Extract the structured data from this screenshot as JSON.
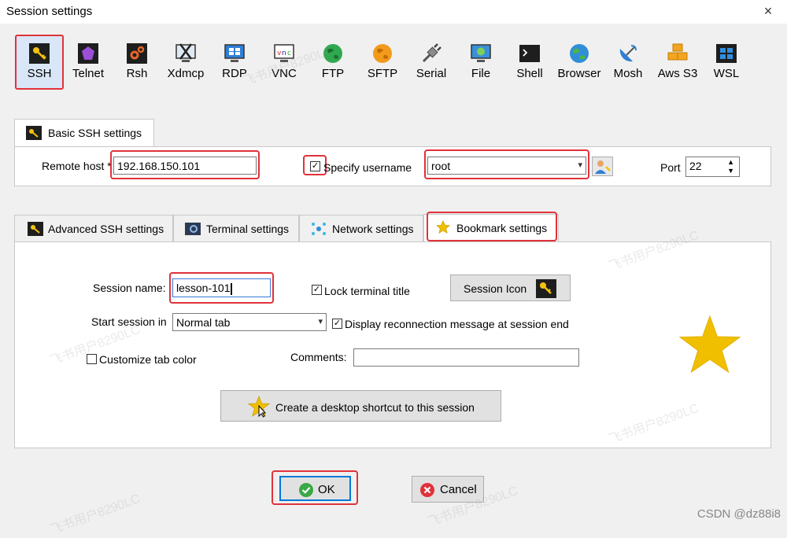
{
  "window": {
    "title": "Session settings",
    "close_glyph": "×"
  },
  "protocols": [
    {
      "label": "SSH",
      "icon": "key-icon",
      "selected": true
    },
    {
      "label": "Telnet",
      "icon": "telnet-icon"
    },
    {
      "label": "Rsh",
      "icon": "rsh-icon"
    },
    {
      "label": "Xdmcp",
      "icon": "xdmcp-icon"
    },
    {
      "label": "RDP",
      "icon": "rdp-monitor-icon"
    },
    {
      "label": "VNC",
      "icon": "vnc-icon"
    },
    {
      "label": "FTP",
      "icon": "ftp-globe-icon"
    },
    {
      "label": "SFTP",
      "icon": "sftp-globe-icon"
    },
    {
      "label": "Serial",
      "icon": "serial-plug-icon"
    },
    {
      "label": "File",
      "icon": "file-monitor-icon"
    },
    {
      "label": "Shell",
      "icon": "shell-terminal-icon"
    },
    {
      "label": "Browser",
      "icon": "browser-globe-icon"
    },
    {
      "label": "Mosh",
      "icon": "mosh-satellite-icon"
    },
    {
      "label": "Aws S3",
      "icon": "aws-s3-boxes-icon"
    },
    {
      "label": "WSL",
      "icon": "wsl-windows-icon"
    }
  ],
  "basic": {
    "tab_label": "Basic SSH settings",
    "remote_host_label": "Remote host *",
    "remote_host_value": "192.168.150.101",
    "specify_username_label": "Specify username",
    "specify_username_checked": "✓",
    "username_value": "root",
    "port_label": "Port",
    "port_value": "22"
  },
  "tabs": [
    {
      "label": "Advanced SSH settings"
    },
    {
      "label": "Terminal settings"
    },
    {
      "label": "Network settings"
    },
    {
      "label": "Bookmark settings",
      "active": true
    }
  ],
  "bookmark": {
    "session_name_label": "Session name:",
    "session_name_value": "lesson-101",
    "lock_title_label": "Lock terminal title",
    "lock_title_checked": "✓",
    "session_icon_label": "Session Icon",
    "start_session_label": "Start session in",
    "start_session_value": "Normal tab",
    "display_reconnect_label": "Display reconnection message at session end",
    "display_reconnect_checked": "✓",
    "customize_color_label": "Customize tab color",
    "comments_label": "Comments:",
    "comments_value": "",
    "shortcut_label": "Create a desktop shortcut to this session"
  },
  "buttons": {
    "ok": "OK",
    "cancel": "Cancel"
  },
  "watermarks": {
    "user": "飞书用户8290LC",
    "csdn": "CSDN @dz88i8"
  },
  "colors": {
    "highlight": "#e0323a",
    "star": "#f0c000",
    "selected_bg": "#d8e6f7"
  }
}
